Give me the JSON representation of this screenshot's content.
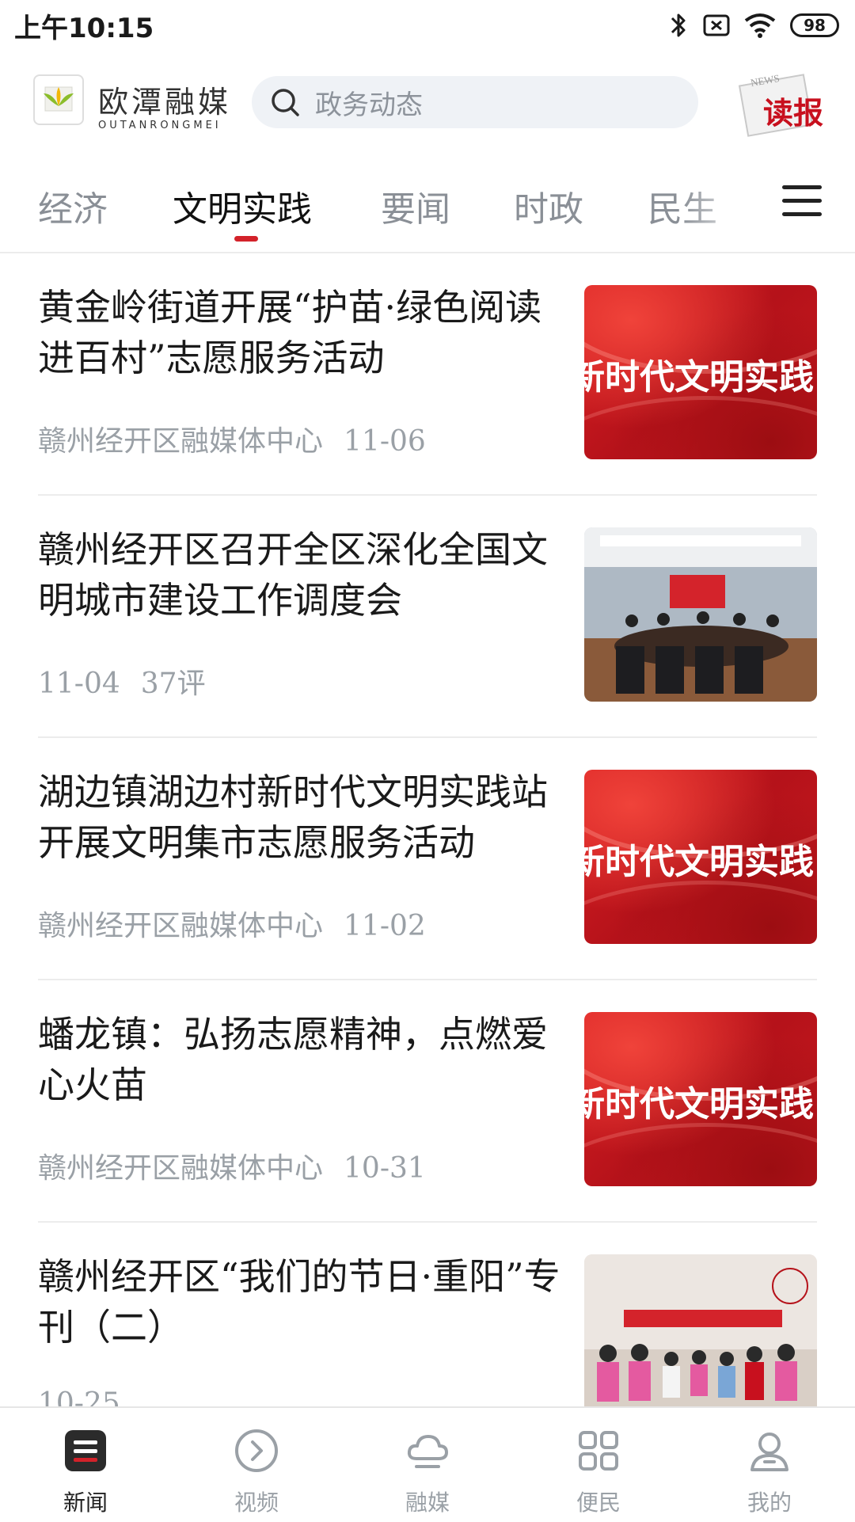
{
  "status_bar": {
    "time": "上午10:15",
    "battery": "98"
  },
  "header": {
    "logo_cn": "欧潭融媒",
    "logo_en": "OUTANRONGMEI",
    "search_placeholder": "政务动态",
    "dubao_label": "读报",
    "dubao_news": "NEWS"
  },
  "tabs": [
    {
      "label": "经济",
      "active": false
    },
    {
      "label": "文明实践",
      "active": true
    },
    {
      "label": "要闻",
      "active": false
    },
    {
      "label": "时政",
      "active": false
    },
    {
      "label": "民生",
      "active": false
    }
  ],
  "news": [
    {
      "title": "黄金岭街道开展“护苗·绿色阅读进百村”志愿服务活动",
      "source": "赣州经开区融媒体中心",
      "date": "11-06",
      "comments": "",
      "thumb_type": "red",
      "thumb_caption": "新时代文明实践"
    },
    {
      "title": "赣州经开区召开全区深化全国文明城市建设工作调度会",
      "source": "",
      "date": "11-04",
      "comments": "37评",
      "thumb_type": "meeting",
      "thumb_caption": ""
    },
    {
      "title": "湖边镇湖边村新时代文明实践站开展文明集市志愿服务活动",
      "source": "赣州经开区融媒体中心",
      "date": "11-02",
      "comments": "",
      "thumb_type": "red",
      "thumb_caption": "新时代文明实践"
    },
    {
      "title": "蟠龙镇：弘扬志愿精神，点燃爱心火苗",
      "source": "赣州经开区融媒体中心",
      "date": "10-31",
      "comments": "",
      "thumb_type": "red",
      "thumb_caption": "新时代文明实践"
    },
    {
      "title": "赣州经开区“我们的节日·重阳”专刊（二）",
      "source": "",
      "date": "10-25",
      "comments": "",
      "thumb_type": "festival",
      "thumb_caption": ""
    }
  ],
  "bottom_nav": [
    {
      "label": "新闻",
      "icon": "news-icon",
      "active": true
    },
    {
      "label": "视频",
      "icon": "video-icon",
      "active": false
    },
    {
      "label": "融媒",
      "icon": "cloud-icon",
      "active": false
    },
    {
      "label": "便民",
      "icon": "grid-icon",
      "active": false
    },
    {
      "label": "我的",
      "icon": "profile-icon",
      "active": false
    }
  ],
  "colors": {
    "accent": "#d3222a",
    "muted_text": "#9aa0a6",
    "search_bg": "#eff2f6"
  }
}
